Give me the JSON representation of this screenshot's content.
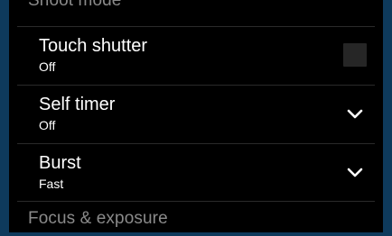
{
  "sections": {
    "top_header": "Shoot mode",
    "bottom_header": "Focus & exposure"
  },
  "rows": [
    {
      "title": "Touch shutter",
      "value": "Off",
      "control": "checkbox",
      "checked": false
    },
    {
      "title": "Self timer",
      "value": "Off",
      "control": "dropdown"
    },
    {
      "title": "Burst",
      "value": "Fast",
      "control": "dropdown"
    }
  ],
  "icons": {
    "dropdown": "chevron-down-icon"
  },
  "colors": {
    "background": "#000000",
    "frame": "#0e3a5c",
    "header_text": "#8a8a8a",
    "primary_text": "#ffffff",
    "divider": "#2a2a2a",
    "checkbox": "#262626"
  }
}
